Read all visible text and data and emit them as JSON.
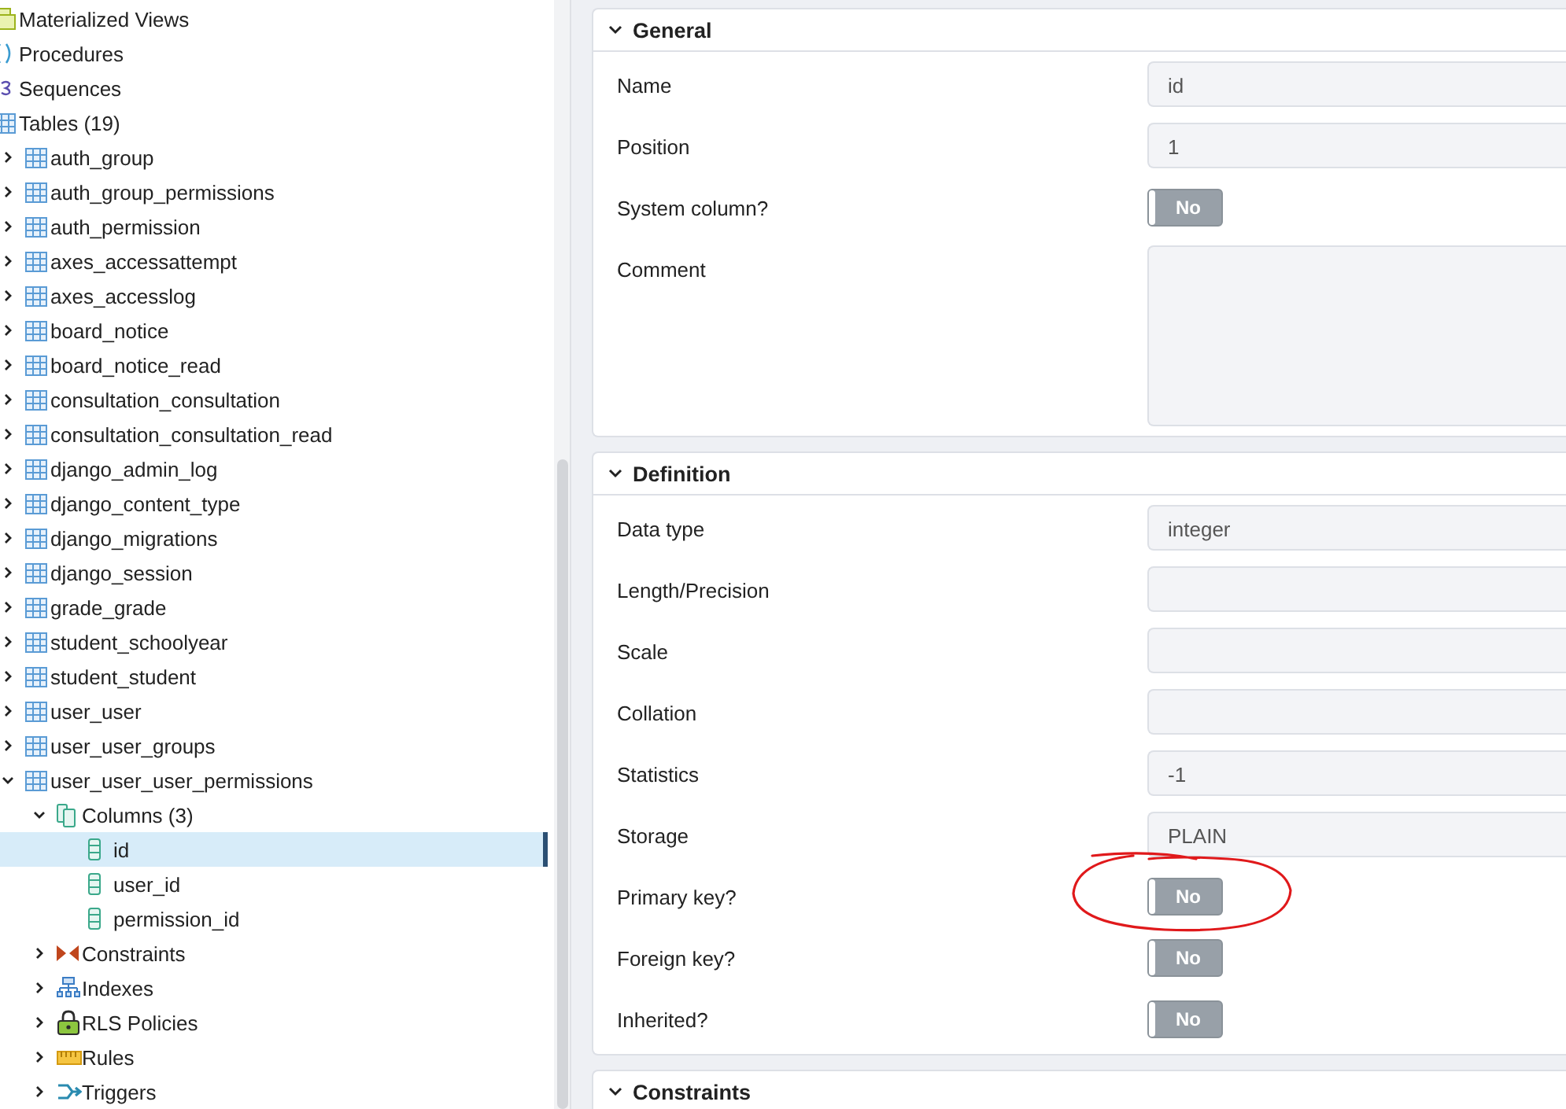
{
  "tree": [
    {
      "label": "Materialized Views",
      "kind": "matview"
    },
    {
      "label": "Procedures",
      "kind": "procedure"
    },
    {
      "label": "Sequences",
      "kind": "sequence"
    },
    {
      "label": "Tables (19)",
      "kind": "tables",
      "children": [
        {
          "label": "auth_group",
          "kind": "table",
          "expanded": false
        },
        {
          "label": "auth_group_permissions",
          "kind": "table",
          "expanded": false
        },
        {
          "label": "auth_permission",
          "kind": "table",
          "expanded": false
        },
        {
          "label": "axes_accessattempt",
          "kind": "table",
          "expanded": false
        },
        {
          "label": "axes_accesslog",
          "kind": "table",
          "expanded": false
        },
        {
          "label": "board_notice",
          "kind": "table",
          "expanded": false
        },
        {
          "label": "board_notice_read",
          "kind": "table",
          "expanded": false
        },
        {
          "label": "consultation_consultation",
          "kind": "table",
          "expanded": false
        },
        {
          "label": "consultation_consultation_read",
          "kind": "table",
          "expanded": false
        },
        {
          "label": "django_admin_log",
          "kind": "table",
          "expanded": false
        },
        {
          "label": "django_content_type",
          "kind": "table",
          "expanded": false
        },
        {
          "label": "django_migrations",
          "kind": "table",
          "expanded": false
        },
        {
          "label": "django_session",
          "kind": "table",
          "expanded": false
        },
        {
          "label": "grade_grade",
          "kind": "table",
          "expanded": false
        },
        {
          "label": "student_schoolyear",
          "kind": "table",
          "expanded": false
        },
        {
          "label": "student_student",
          "kind": "table",
          "expanded": false
        },
        {
          "label": "user_user",
          "kind": "table",
          "expanded": false
        },
        {
          "label": "user_user_groups",
          "kind": "table",
          "expanded": false
        },
        {
          "label": "user_user_user_permissions",
          "kind": "table",
          "expanded": true,
          "children": [
            {
              "label": "Columns (3)",
              "kind": "columns",
              "expanded": true,
              "children": [
                {
                  "label": "id",
                  "kind": "column",
                  "selected": true
                },
                {
                  "label": "user_id",
                  "kind": "column",
                  "selected": false
                },
                {
                  "label": "permission_id",
                  "kind": "column",
                  "selected": false
                }
              ]
            },
            {
              "label": "Constraints",
              "kind": "constraints",
              "expanded": false
            },
            {
              "label": "Indexes",
              "kind": "indexes",
              "expanded": false
            },
            {
              "label": "RLS Policies",
              "kind": "rls",
              "expanded": false
            },
            {
              "label": "Rules",
              "kind": "rules",
              "expanded": false
            },
            {
              "label": "Triggers",
              "kind": "triggers",
              "expanded": false
            }
          ]
        }
      ]
    }
  ],
  "sections": [
    {
      "title": "General",
      "expanded": true,
      "fields": [
        {
          "label": "Name",
          "kind": "text",
          "value": "id"
        },
        {
          "label": "Position",
          "kind": "text",
          "value": "1"
        },
        {
          "label": "System column?",
          "kind": "toggle",
          "on": false,
          "text": "No"
        },
        {
          "label": "Comment",
          "kind": "textarea"
        }
      ]
    },
    {
      "title": "Definition",
      "expanded": true,
      "fields": [
        {
          "label": "Data type",
          "kind": "text",
          "value": "integer"
        },
        {
          "label": "Length/Precision",
          "kind": "text"
        },
        {
          "label": "Scale",
          "kind": "text"
        },
        {
          "label": "Collation",
          "kind": "text"
        },
        {
          "label": "Statistics",
          "kind": "text",
          "value": "-1"
        },
        {
          "label": "Storage",
          "kind": "text",
          "value": "PLAIN"
        },
        {
          "label": "Primary key?",
          "kind": "toggle",
          "on": false,
          "text": "No"
        },
        {
          "label": "Foreign key?",
          "kind": "toggle",
          "on": false,
          "text": "No"
        },
        {
          "label": "Inherited?",
          "kind": "toggle",
          "on": false,
          "text": "No"
        }
      ]
    },
    {
      "title": "Constraints",
      "expanded": true
    }
  ]
}
